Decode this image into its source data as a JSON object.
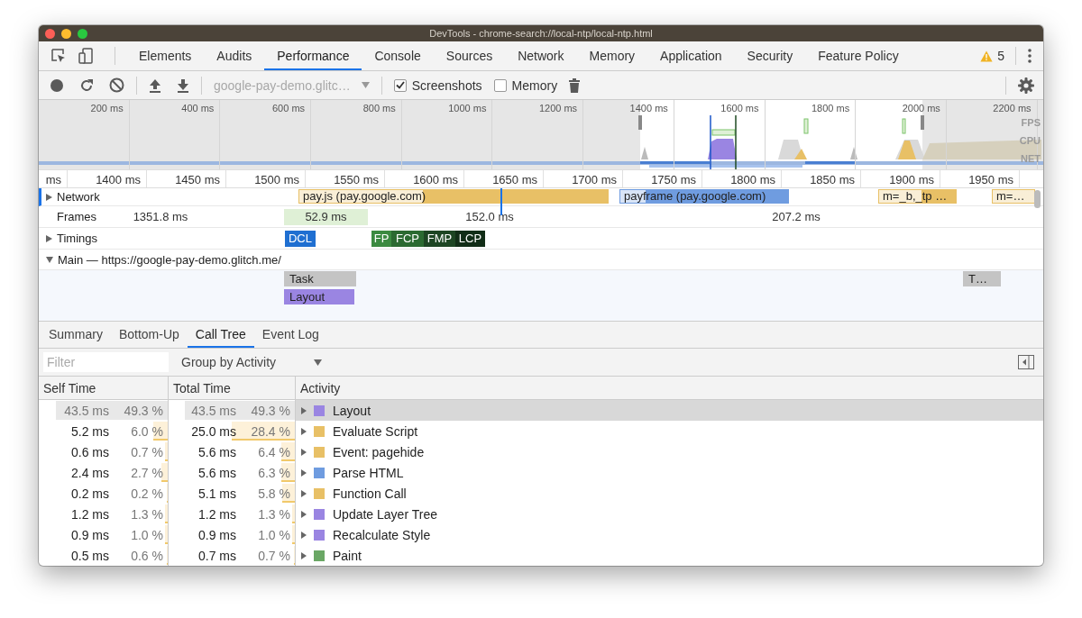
{
  "window": {
    "title": "DevTools - chrome-search://local-ntp/local-ntp.html"
  },
  "tabs": [
    {
      "label": "Elements",
      "selected": false
    },
    {
      "label": "Audits",
      "selected": false
    },
    {
      "label": "Performance",
      "selected": true
    },
    {
      "label": "Console",
      "selected": false
    },
    {
      "label": "Sources",
      "selected": false
    },
    {
      "label": "Network",
      "selected": false
    },
    {
      "label": "Memory",
      "selected": false
    },
    {
      "label": "Application",
      "selected": false
    },
    {
      "label": "Security",
      "selected": false
    },
    {
      "label": "Feature Policy",
      "selected": false
    }
  ],
  "warnings": {
    "count": "5"
  },
  "toolbar": {
    "recording": {
      "value": "google-pay-demo.glitc…",
      "disabled": true
    },
    "checkboxes": [
      {
        "label": "Screenshots",
        "checked": true
      },
      {
        "label": "Memory",
        "checked": false
      }
    ]
  },
  "overview": {
    "ticks": [
      "200 ms",
      "400 ms",
      "600 ms",
      "800 ms",
      "1000 ms",
      "1200 ms",
      "1400 ms",
      "1600 ms",
      "1800 ms",
      "2000 ms",
      "2200 ms"
    ],
    "lanes": [
      "FPS",
      "CPU",
      "NET"
    ]
  },
  "flame_chart": {
    "ruler": [
      "ms",
      "1400 ms",
      "1450 ms",
      "1500 ms",
      "1550 ms",
      "1600 ms",
      "1650 ms",
      "1700 ms",
      "1750 ms",
      "1800 ms",
      "1850 ms",
      "1900 ms",
      "1950 ms"
    ],
    "network": {
      "label": "Network",
      "expanded": false,
      "requests": [
        {
          "label": "pay.js (pay.google.com)",
          "color": "#e8c066"
        },
        {
          "label": "payframe (pay.google.com)",
          "color": "#6f9ce0"
        },
        {
          "label": "m=_b,_tp …",
          "color": "#e8c066"
        },
        {
          "label": "m=…",
          "color": "#e8c066"
        }
      ]
    },
    "frames": {
      "label": "Frames",
      "durations": [
        "1351.8 ms",
        "52.9 ms",
        "152.0 ms",
        "207.2 ms"
      ]
    },
    "timings": {
      "label": "Timings",
      "expanded": false,
      "markers": [
        {
          "label": "DCL",
          "color": "#1f6fd1"
        },
        {
          "label": "FP",
          "color": "#3b8a40"
        },
        {
          "label": "FCP",
          "color": "#2b6a31"
        },
        {
          "label": "FMP",
          "color": "#1d4523"
        },
        {
          "label": "LCP",
          "color": "#112d17"
        }
      ]
    },
    "main": {
      "label": "Main — https://google-pay-demo.glitch.me/",
      "expanded": true,
      "events": [
        {
          "label": "Task",
          "color": "#c4c4c4"
        },
        {
          "label": "Layout",
          "color": "#9a85e2"
        },
        {
          "label": "T…",
          "color": "#c4c4c4"
        }
      ]
    }
  },
  "details_tabs": [
    {
      "label": "Summary",
      "selected": false
    },
    {
      "label": "Bottom-Up",
      "selected": false
    },
    {
      "label": "Call Tree",
      "selected": true
    },
    {
      "label": "Event Log",
      "selected": false
    }
  ],
  "filter": {
    "placeholder": "Filter"
  },
  "grouping": {
    "value": "Group by Activity"
  },
  "table": {
    "columns": [
      "Self Time",
      "Total Time",
      "Activity"
    ],
    "rows": [
      {
        "self": {
          "time": "43.5 ms",
          "percent": "49.3 %",
          "level": 0.87
        },
        "total": {
          "time": "43.5 ms",
          "percent": "49.3 %",
          "level": 0.87
        },
        "activity": "Layout",
        "color": "#9a85e2",
        "selected": true
      },
      {
        "self": {
          "time": "5.2 ms",
          "percent": "6.0 %",
          "level": 0.11
        },
        "total": {
          "time": "25.0 ms",
          "percent": "28.4 %",
          "level": 0.5
        },
        "activity": "Evaluate Script",
        "color": "#e8c066",
        "selected": false
      },
      {
        "self": {
          "time": "0.6 ms",
          "percent": "0.7 %",
          "level": 0.02
        },
        "total": {
          "time": "5.6 ms",
          "percent": "6.4 %",
          "level": 0.11
        },
        "activity": "Event: pagehide",
        "color": "#e8c066",
        "selected": false
      },
      {
        "self": {
          "time": "2.4 ms",
          "percent": "2.7 %",
          "level": 0.05
        },
        "total": {
          "time": "5.6 ms",
          "percent": "6.3 %",
          "level": 0.11
        },
        "activity": "Parse HTML",
        "color": "#6f9ce0",
        "selected": false
      },
      {
        "self": {
          "time": "0.2 ms",
          "percent": "0.2 %",
          "level": 0.01
        },
        "total": {
          "time": "5.1 ms",
          "percent": "5.8 %",
          "level": 0.1
        },
        "activity": "Function Call",
        "color": "#e8c066",
        "selected": false
      },
      {
        "self": {
          "time": "1.2 ms",
          "percent": "1.3 %",
          "level": 0.02
        },
        "total": {
          "time": "1.2 ms",
          "percent": "1.3 %",
          "level": 0.02
        },
        "activity": "Update Layer Tree",
        "color": "#9a85e2",
        "selected": false
      },
      {
        "self": {
          "time": "0.9 ms",
          "percent": "1.0 %",
          "level": 0.02
        },
        "total": {
          "time": "0.9 ms",
          "percent": "1.0 %",
          "level": 0.02
        },
        "activity": "Recalculate Style",
        "color": "#9a85e2",
        "selected": false
      },
      {
        "self": {
          "time": "0.5 ms",
          "percent": "0.6 %",
          "level": 0.01
        },
        "total": {
          "time": "0.7 ms",
          "percent": "0.7 %",
          "level": 0.01
        },
        "activity": "Paint",
        "color": "#6aa765",
        "selected": false
      }
    ]
  }
}
